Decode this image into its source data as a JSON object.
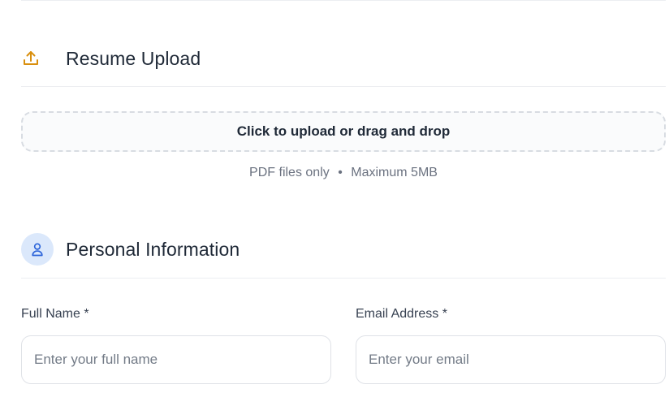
{
  "resume": {
    "title": "Resume Upload",
    "icon": "upload-icon",
    "dropzone_text": "Click to upload or drag and drop",
    "hint_types": "PDF files only",
    "hint_separator": "•",
    "hint_size": "Maximum 5MB"
  },
  "personal": {
    "title": "Personal Information",
    "icon": "person-icon",
    "full_name": {
      "label": "Full Name *",
      "placeholder": "Enter your full name",
      "value": ""
    },
    "email": {
      "label": "Email Address *",
      "placeholder": "Enter your email",
      "value": ""
    }
  },
  "colors": {
    "upload_icon": "#d98f0e",
    "person_icon": "#2b63d9",
    "person_icon_bg": "#dbe8fb"
  }
}
